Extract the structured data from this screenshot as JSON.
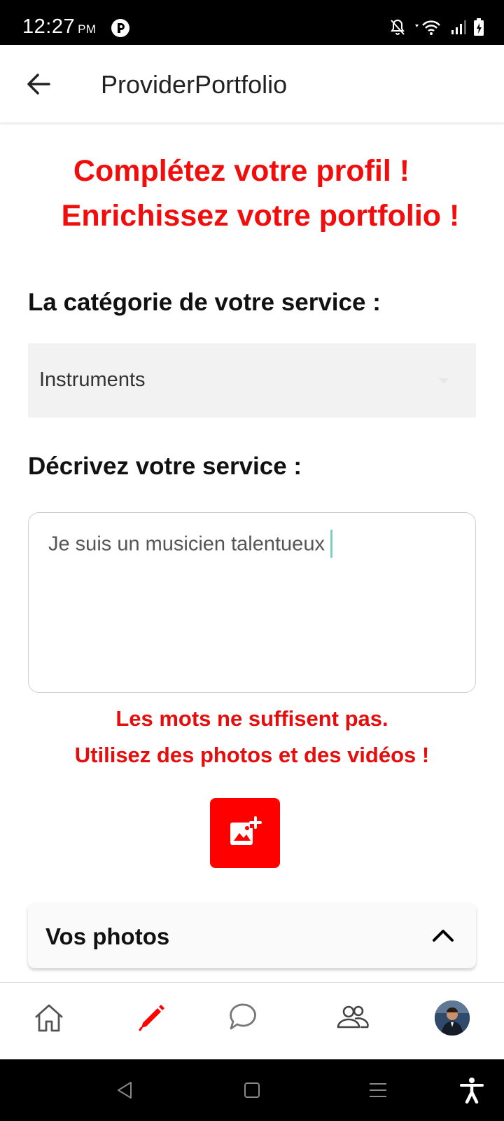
{
  "status_bar": {
    "time": "12:27",
    "ampm": "PM",
    "icons": [
      "app-notification-icon",
      "bell-off-icon",
      "wifi-icon",
      "signal-icon",
      "battery-icon"
    ]
  },
  "app_bar": {
    "title": "ProviderPortfolio",
    "back_icon": "arrow-left-icon"
  },
  "headline": {
    "line1": "Complétez votre profil !",
    "line2": "Enrichissez votre portfolio !"
  },
  "category": {
    "label": "La catégorie de votre service :",
    "selected_value": "Instruments"
  },
  "description": {
    "label": "Décrivez votre service :",
    "value": "Je suis un musicien talentueux"
  },
  "media_hint": {
    "line1": "Les mots ne suffisent pas.",
    "line2": "Utilisez des photos et des vidéos !"
  },
  "add_media_button": {
    "icon": "add-photo-icon"
  },
  "photos_section": {
    "title": "Vos photos",
    "expanded": true
  },
  "bottom_nav": {
    "items": [
      {
        "icon": "home-icon",
        "active": false
      },
      {
        "icon": "pencil-icon",
        "active": true
      },
      {
        "icon": "chat-icon",
        "active": false
      },
      {
        "icon": "people-icon",
        "active": false
      },
      {
        "icon": "avatar",
        "active": false
      }
    ]
  },
  "system_nav": [
    "back-triangle-icon",
    "home-square-icon",
    "menu-lines-icon",
    "accessibility-icon"
  ],
  "colors": {
    "accent_red": "#f20d0d",
    "status_bar_bg": "#000000",
    "dropdown_bg": "#f2f2f2"
  }
}
